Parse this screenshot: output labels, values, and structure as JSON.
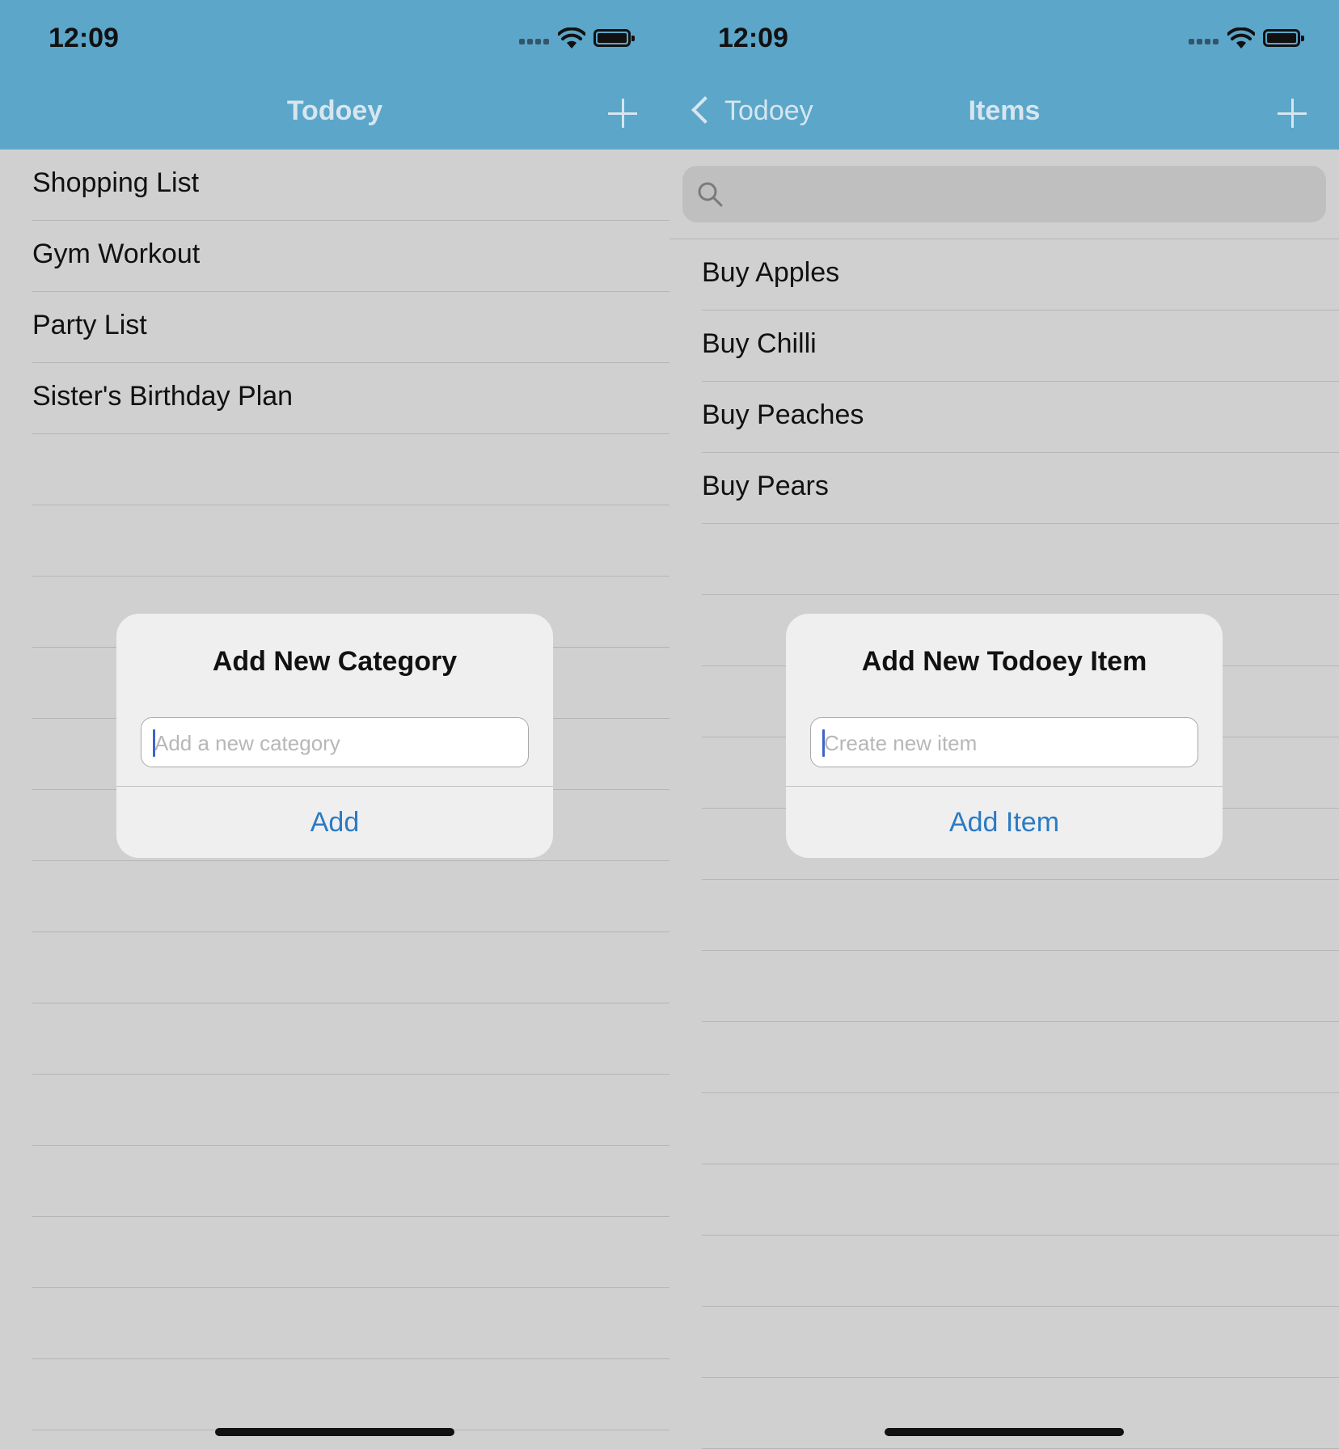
{
  "left_screen": {
    "status": {
      "time": "12:09"
    },
    "nav": {
      "title": "Todoey"
    },
    "categories": [
      "Shopping List",
      "Gym Workout",
      "Party List",
      "Sister's Birthday Plan"
    ],
    "dialog": {
      "title": "Add New Category",
      "placeholder": "Add a new category",
      "action": "Add"
    }
  },
  "right_screen": {
    "status": {
      "time": "12:09"
    },
    "nav": {
      "back_label": "Todoey",
      "title": "Items"
    },
    "search": {
      "value": ""
    },
    "items": [
      "Buy Apples",
      "Buy Chilli",
      "Buy Peaches",
      "Buy Pears"
    ],
    "dialog": {
      "title": "Add New Todoey Item",
      "placeholder": "Create new item",
      "action": "Add Item"
    }
  },
  "colors": {
    "navbar": "#5ca6ca",
    "background": "#d0d0d0",
    "accent": "#2a7bc4"
  },
  "icons": [
    "signal-icon",
    "wifi-icon",
    "battery-icon",
    "plus-icon",
    "back-chevron-icon",
    "search-icon"
  ]
}
